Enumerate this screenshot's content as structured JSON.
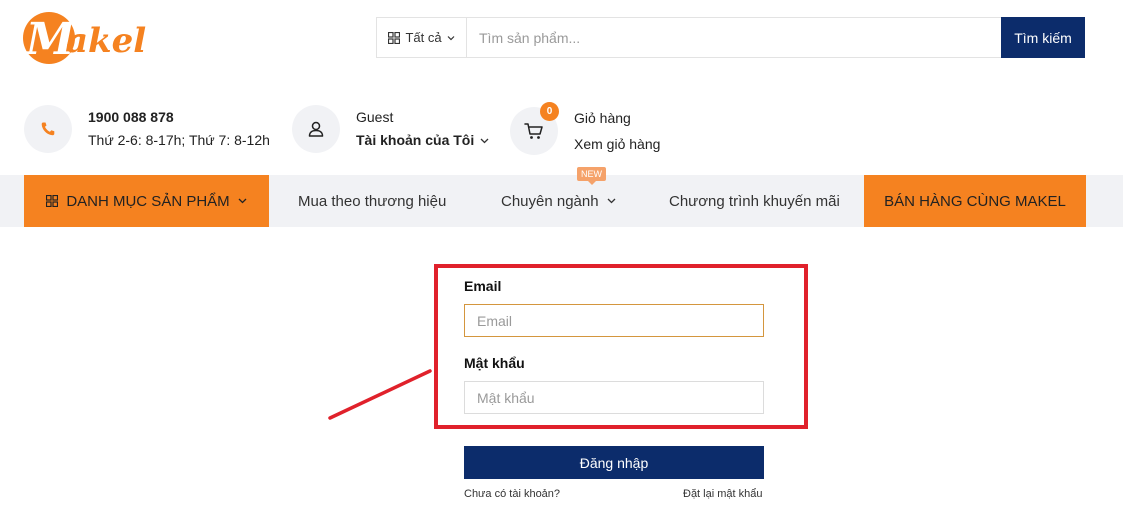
{
  "brand": {
    "logo_text": "Makel",
    "accent": "#f58220",
    "navy": "#0c2c6b"
  },
  "search": {
    "category_label": "Tất cả",
    "placeholder": "Tìm sản phẩm...",
    "button_label": "Tìm kiếm"
  },
  "contact": {
    "phone": "1900 088 878",
    "hours": "Thứ 2-6: 8-17h; Thứ 7: 8-12h"
  },
  "account": {
    "user": "Guest",
    "menu_label": "Tài khoản của Tôi"
  },
  "cart": {
    "count": "0",
    "title": "Giỏ hàng",
    "link": "Xem giỏ hàng"
  },
  "nav": {
    "categories": "DANH MỤC SẢN PHẨM",
    "brands": "Mua theo thương hiệu",
    "specialty": "Chuyên ngành",
    "new_tag": "NEW",
    "promotions": "Chương trình khuyến mãi",
    "sell": "BÁN HÀNG CÙNG MAKEL"
  },
  "login": {
    "email_label": "Email",
    "email_placeholder": "Email",
    "password_label": "Mật khẩu",
    "password_placeholder": "Mật khẩu",
    "submit_label": "Đăng nhập",
    "register_link": "Chưa có tài khoản?",
    "reset_link": "Đặt lại mật khẩu"
  }
}
